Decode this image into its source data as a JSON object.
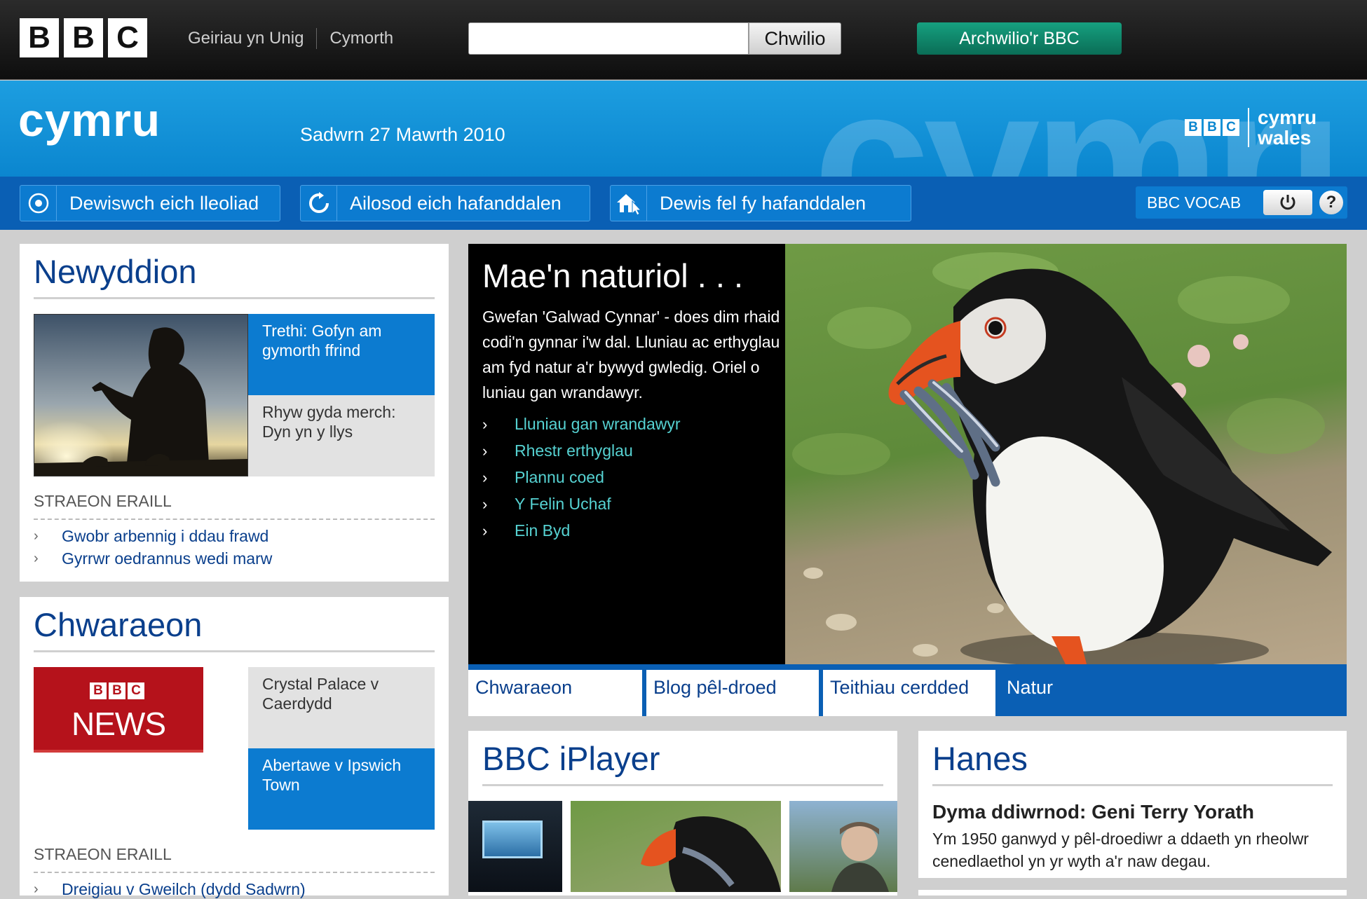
{
  "topbar": {
    "logo_letters": [
      "B",
      "B",
      "C"
    ],
    "link_text_only": "Geiriau yn Unig",
    "link_accessibility": "Cymorth",
    "search_placeholder": "",
    "search_button": "Chwilio",
    "explore_button": "Archwilio'r BBC"
  },
  "header": {
    "title": "cymru",
    "date": "Sadwrn 27 Mawrth 2010",
    "brand_logo": "BBC",
    "brand_line1": "cymru",
    "brand_line2": "wales",
    "background_word": "cymru"
  },
  "toolbar": {
    "location": "Dewiswch eich lleoliad",
    "reset": "Ailosod eich hafanddalen",
    "set_home": "Dewis fel fy hafanddalen",
    "vocab": "BBC VOCAB",
    "help": "?"
  },
  "news": {
    "title": "Newyddion",
    "main_story": "Trethi: Gofyn am gymorth ffrind",
    "second_story": "Rhyw gyda merch: Dyn yn y llys",
    "other_heading": "STRAEON ERAILL",
    "others": [
      "Gwobr arbennig i ddau frawd",
      "Gyrrwr oedrannus wedi marw"
    ]
  },
  "sport": {
    "title": "Chwaraeon",
    "logo_top": "BBC",
    "logo_bottom": "NEWS",
    "story1": "Crystal Palace v Caerdydd",
    "story2": "Abertawe v Ipswich Town",
    "other_heading": "STRAEON ERAILL",
    "others": [
      "Dreigiau v Gweilch (dydd Sadwrn)"
    ]
  },
  "feature": {
    "title": "Mae'n naturiol . . .",
    "description": "Gwefan 'Galwad Cynnar' - does dim rhaid codi'n gynnar i'w dal. Lluniau ac erthyglau am fyd natur a'r bywyd gwledig. Oriel o luniau gan wrandawyr.",
    "links": [
      "Lluniau gan wrandawyr",
      "Rhestr erthyglau",
      "Plannu coed",
      "Y Felin Uchaf",
      "Ein Byd"
    ],
    "tabs": [
      "Chwaraeon",
      "Blog pêl-droed",
      "Teithiau cerdded",
      "Natur"
    ],
    "active_tab": "Natur"
  },
  "iplayer": {
    "title": "BBC iPlayer"
  },
  "history": {
    "title": "Hanes",
    "headline": "Dyma ddiwrnod: Geni Terry Yorath",
    "body": "Ym 1950 ganwyd y pêl-droediwr a ddaeth yn rheolwr cenedlaethol yn yr wyth a'r naw degau."
  },
  "colors": {
    "brand_blue": "#0c7bd0",
    "dark_blue": "#0a5fb4",
    "heading_blue": "#0a3f8c",
    "link_cyan": "#56d2d2",
    "explore_green": "#0e8a6b",
    "news_red": "#b5121b"
  }
}
